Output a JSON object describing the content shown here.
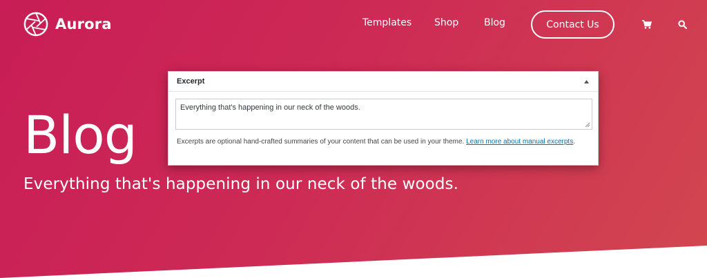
{
  "brand": {
    "name": "Aurora",
    "logo_icon": "aperture-icon"
  },
  "nav": {
    "items": [
      {
        "label": "Templates"
      },
      {
        "label": "Shop"
      },
      {
        "label": "Blog"
      }
    ],
    "contact_label": "Contact Us",
    "cart_icon": "cart-icon",
    "search_icon": "search-icon"
  },
  "hero": {
    "title": "Blog",
    "tagline": "Everything that's happening in our neck of the woods."
  },
  "excerpt_panel": {
    "heading": "Excerpt",
    "toggle_icon": "collapse-arrow-icon",
    "value": "Everything that's happening in our neck of the woods.",
    "help_text": "Excerpts are optional hand-crafted summaries of your content that can be used in your theme.",
    "help_link": "Learn more about manual excerpts",
    "help_suffix": "."
  },
  "colors": {
    "gradient_start": "#c81d56",
    "gradient_end": "#d2474f",
    "link": "#0073aa"
  }
}
